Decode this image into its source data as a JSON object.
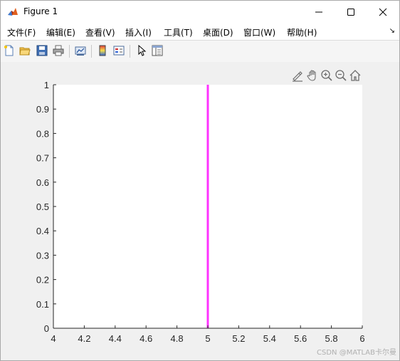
{
  "window": {
    "title": "Figure 1",
    "controls": [
      "minimize",
      "maximize",
      "close"
    ]
  },
  "menubar": {
    "items": [
      {
        "label": "文件(F)"
      },
      {
        "label": "编辑(E)"
      },
      {
        "label": "查看(V)"
      },
      {
        "label": "插入(I)"
      },
      {
        "label": "工具(T)"
      },
      {
        "label": "桌面(D)"
      },
      {
        "label": "窗口(W)"
      },
      {
        "label": "帮助(H)"
      }
    ],
    "overflow_icon": "arrow-icon"
  },
  "toolbar": {
    "buttons": [
      "new-figure-icon",
      "open-file-icon",
      "save-icon",
      "print-icon",
      "link-plot-icon",
      "colorbar-icon",
      "legend-icon",
      "edit-plot-icon",
      "property-inspector-icon"
    ]
  },
  "axes_toolbar": {
    "buttons": [
      "brush-icon",
      "pan-icon",
      "zoom-in-icon",
      "zoom-out-icon",
      "home-icon"
    ]
  },
  "chart_data": {
    "type": "line",
    "title": "",
    "xlabel": "",
    "ylabel": "",
    "xlim": [
      4,
      6
    ],
    "ylim": [
      0,
      1
    ],
    "x_ticks": [
      "4",
      "4.2",
      "4.4",
      "4.6",
      "4.8",
      "5",
      "5.2",
      "5.4",
      "5.6",
      "5.8",
      "6"
    ],
    "y_ticks": [
      "0",
      "0.1",
      "0.2",
      "0.3",
      "0.4",
      "0.5",
      "0.6",
      "0.7",
      "0.8",
      "0.9",
      "1"
    ],
    "grid": false,
    "series": [
      {
        "x": [
          5,
          5
        ],
        "y": [
          0,
          1
        ],
        "color": "#ff33ff"
      }
    ]
  },
  "watermark": "CSDN @MATLAB卡尔曼"
}
